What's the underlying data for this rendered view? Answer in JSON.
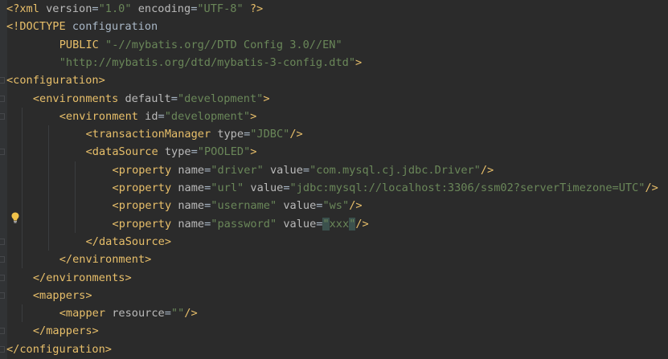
{
  "editor": {
    "lines": [
      {
        "indent": 0,
        "tokens": [
          {
            "t": "<?xml ",
            "c": "pi"
          },
          {
            "t": "version",
            "c": "attr"
          },
          {
            "t": "=",
            "c": "text"
          },
          {
            "t": "\"1.0\"",
            "c": "str"
          },
          {
            "t": " ",
            "c": "text"
          },
          {
            "t": "encoding",
            "c": "attr"
          },
          {
            "t": "=",
            "c": "text"
          },
          {
            "t": "\"UTF-8\"",
            "c": "str"
          },
          {
            "t": " ?>",
            "c": "pi"
          }
        ]
      },
      {
        "indent": 0,
        "tokens": [
          {
            "t": "<!DOCTYPE ",
            "c": "doc"
          },
          {
            "t": "configuration",
            "c": "text"
          }
        ]
      },
      {
        "indent": 8,
        "tokens": [
          {
            "t": "PUBLIC ",
            "c": "doc"
          },
          {
            "t": "\"-//mybatis.org//DTD Config 3.0//EN\"",
            "c": "str"
          }
        ]
      },
      {
        "indent": 8,
        "tokens": [
          {
            "t": "\"http://mybatis.org/dtd/mybatis-3-config.dtd\"",
            "c": "str"
          },
          {
            "t": ">",
            "c": "doc"
          }
        ]
      },
      {
        "indent": 0,
        "tokens": [
          {
            "t": "<configuration>",
            "c": "tag"
          }
        ]
      },
      {
        "indent": 4,
        "tokens": [
          {
            "t": "<environments ",
            "c": "tag"
          },
          {
            "t": "default",
            "c": "attr"
          },
          {
            "t": "=",
            "c": "text"
          },
          {
            "t": "\"development\"",
            "c": "str"
          },
          {
            "t": ">",
            "c": "tag"
          }
        ]
      },
      {
        "indent": 8,
        "tokens": [
          {
            "t": "<environment ",
            "c": "tag"
          },
          {
            "t": "id",
            "c": "attr"
          },
          {
            "t": "=",
            "c": "text"
          },
          {
            "t": "\"development\"",
            "c": "str"
          },
          {
            "t": ">",
            "c": "tag"
          }
        ]
      },
      {
        "indent": 12,
        "tokens": [
          {
            "t": "<transactionManager ",
            "c": "tag"
          },
          {
            "t": "type",
            "c": "attr"
          },
          {
            "t": "=",
            "c": "text"
          },
          {
            "t": "\"JDBC\"",
            "c": "str"
          },
          {
            "t": "/>",
            "c": "tag"
          }
        ]
      },
      {
        "indent": 12,
        "tokens": [
          {
            "t": "<dataSource ",
            "c": "tag"
          },
          {
            "t": "type",
            "c": "attr"
          },
          {
            "t": "=",
            "c": "text"
          },
          {
            "t": "\"POOLED\"",
            "c": "str"
          },
          {
            "t": ">",
            "c": "tag"
          }
        ]
      },
      {
        "indent": 16,
        "tokens": [
          {
            "t": "<property ",
            "c": "tag"
          },
          {
            "t": "name",
            "c": "attr"
          },
          {
            "t": "=",
            "c": "text"
          },
          {
            "t": "\"driver\"",
            "c": "str"
          },
          {
            "t": " ",
            "c": "text"
          },
          {
            "t": "value",
            "c": "attr"
          },
          {
            "t": "=",
            "c": "text"
          },
          {
            "t": "\"com.mysql.cj.jdbc.Driver\"",
            "c": "str"
          },
          {
            "t": "/>",
            "c": "tag"
          }
        ]
      },
      {
        "indent": 16,
        "tokens": [
          {
            "t": "<property ",
            "c": "tag"
          },
          {
            "t": "name",
            "c": "attr"
          },
          {
            "t": "=",
            "c": "text"
          },
          {
            "t": "\"url\"",
            "c": "str"
          },
          {
            "t": " ",
            "c": "text"
          },
          {
            "t": "value",
            "c": "attr"
          },
          {
            "t": "=",
            "c": "text"
          },
          {
            "t": "\"jdbc:mysql://localhost:3306/ssm02?serverTimezone=UTC\"",
            "c": "str"
          },
          {
            "t": "/>",
            "c": "tag"
          }
        ]
      },
      {
        "indent": 16,
        "tokens": [
          {
            "t": "<property ",
            "c": "tag"
          },
          {
            "t": "name",
            "c": "attr"
          },
          {
            "t": "=",
            "c": "text"
          },
          {
            "t": "\"username\"",
            "c": "str"
          },
          {
            "t": " ",
            "c": "text"
          },
          {
            "t": "value",
            "c": "attr"
          },
          {
            "t": "=",
            "c": "text"
          },
          {
            "t": "\"ws\"",
            "c": "str"
          },
          {
            "t": "/>",
            "c": "tag"
          }
        ]
      },
      {
        "indent": 16,
        "tokens": [
          {
            "t": "<property ",
            "c": "tag"
          },
          {
            "t": "name",
            "c": "attr"
          },
          {
            "t": "=",
            "c": "text"
          },
          {
            "t": "\"password\"",
            "c": "str"
          },
          {
            "t": " ",
            "c": "text"
          },
          {
            "t": "value",
            "c": "attr"
          },
          {
            "t": "=",
            "c": "text"
          },
          {
            "t": "\"",
            "c": "str",
            "hl": true
          },
          {
            "t": "xxx",
            "c": "str"
          },
          {
            "t": "\"",
            "c": "str",
            "hl": true
          },
          {
            "t": "/>",
            "c": "tag"
          }
        ]
      },
      {
        "indent": 12,
        "tokens": [
          {
            "t": "</dataSource>",
            "c": "tag"
          }
        ]
      },
      {
        "indent": 8,
        "tokens": [
          {
            "t": "</environment>",
            "c": "tag"
          }
        ]
      },
      {
        "indent": 4,
        "tokens": [
          {
            "t": "</environments>",
            "c": "tag"
          }
        ]
      },
      {
        "indent": 4,
        "tokens": [
          {
            "t": "<mappers>",
            "c": "tag"
          }
        ]
      },
      {
        "indent": 8,
        "tokens": [
          {
            "t": "<mapper ",
            "c": "tag"
          },
          {
            "t": "resource",
            "c": "attr"
          },
          {
            "t": "=",
            "c": "text"
          },
          {
            "t": "\"\"",
            "c": "str"
          },
          {
            "t": "/>",
            "c": "tag"
          }
        ]
      },
      {
        "indent": 4,
        "tokens": [
          {
            "t": "</mappers>",
            "c": "tag"
          }
        ]
      },
      {
        "indent": 0,
        "tokens": [
          {
            "t": "</configuration>",
            "c": "tag"
          }
        ]
      }
    ]
  },
  "intention_bulb": {
    "icon": "lightbulb-icon",
    "color": "#f0c24a"
  },
  "colors": {
    "background": "#2b2b2b",
    "tag": "#e8bf6a",
    "attribute": "#bababa",
    "string": "#6a8759",
    "text": "#a9b7c6"
  }
}
